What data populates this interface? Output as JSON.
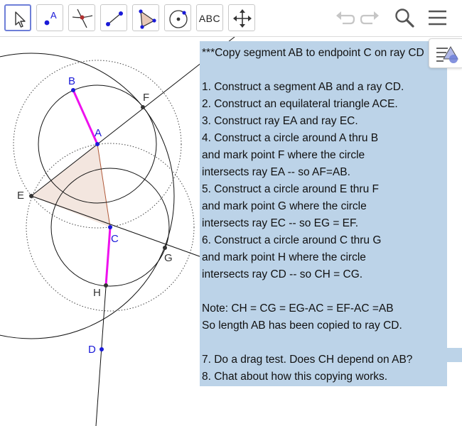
{
  "toolbar": {
    "tools": [
      {
        "name": "move-tool",
        "icon": "cursor-arrow-icon"
      },
      {
        "name": "point-tool",
        "icon": "point-icon",
        "label": "A"
      },
      {
        "name": "intersect-tool",
        "icon": "intersect-icon"
      },
      {
        "name": "segment-tool",
        "icon": "segment-icon"
      },
      {
        "name": "polygon-tool",
        "icon": "polygon-icon"
      },
      {
        "name": "circle-tool",
        "icon": "circle-center-point-icon"
      },
      {
        "name": "text-tool",
        "icon": "text-icon",
        "label": "ABC"
      },
      {
        "name": "move-view-tool",
        "icon": "move-arrows-icon"
      }
    ],
    "right": [
      "undo-icon",
      "redo-icon",
      "search-icon",
      "menu-icon"
    ]
  },
  "colors": {
    "accent": "#6e7fd8",
    "segment": "#ee11ee",
    "point_label": "#1a1ad8",
    "triangle_fill": "#f3e6df",
    "textbox_bg": "#bcd3e8"
  },
  "points": {
    "A": "A",
    "B": "B",
    "C": "C",
    "D": "D",
    "E": "E",
    "F": "F",
    "G": "G",
    "H": "H"
  },
  "note": {
    "lines": [
      "***Copy segment AB to endpoint C on ray CD",
      "",
      "1. Construct a segment AB and a ray CD.",
      "2. Construct an equilateral triangle ACE.",
      "3. Construct ray EA and ray EC.",
      "4. Construct a circle around A thru B",
      "and mark point F where the circle",
      "intersects ray EA -- so AF=AB.",
      "5. Construct a circle around E thru F",
      "and mark point G where the circle",
      "intersects ray EC -- so EG = EF.",
      "6. Construct a circle around C thru G",
      "and mark point H where the circle",
      "intersects ray CD -- so CH = CG.",
      "",
      "Note: CH = CG = EG-AC = EF-AC =AB",
      "So length AB has been copied to ray CD.",
      "",
      "7. Do a drag test. Does CH depend on AB?",
      "8. Chat about how this copying works."
    ]
  }
}
